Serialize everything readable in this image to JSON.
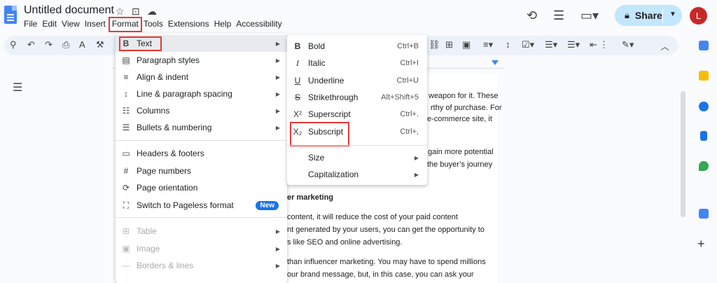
{
  "document": {
    "title": "Untitled document"
  },
  "menubar": [
    "File",
    "Edit",
    "View",
    "Insert",
    "Format",
    "Tools",
    "Extensions",
    "Help",
    "Accessibility"
  ],
  "share": {
    "label": "Share"
  },
  "avatar": {
    "initial": "L"
  },
  "format_menu": {
    "items": [
      {
        "label": "Text",
        "icon": "bold-icon",
        "submenu": true
      },
      {
        "label": "Paragraph styles",
        "icon": "paragraph-styles-icon",
        "submenu": true
      },
      {
        "label": "Align & indent",
        "icon": "align-icon",
        "submenu": true
      },
      {
        "label": "Line & paragraph spacing",
        "icon": "line-spacing-icon",
        "submenu": true
      },
      {
        "label": "Columns",
        "icon": "columns-icon",
        "submenu": true
      },
      {
        "label": "Bullets & numbering",
        "icon": "bullets-icon",
        "submenu": true
      },
      {
        "label": "Headers & footers",
        "icon": "headers-icon",
        "submenu": false
      },
      {
        "label": "Page numbers",
        "icon": "hash-icon",
        "submenu": false
      },
      {
        "label": "Page orientation",
        "icon": "page-orientation-icon",
        "submenu": false
      },
      {
        "label": "Switch to Pageless format",
        "icon": "pageless-icon",
        "submenu": false,
        "badge": "New"
      },
      {
        "label": "Table",
        "icon": "table-icon",
        "submenu": true,
        "disabled": true
      },
      {
        "label": "Image",
        "icon": "image-icon",
        "submenu": true,
        "disabled": true
      },
      {
        "label": "Borders & lines",
        "icon": "borders-icon",
        "submenu": true,
        "disabled": true
      }
    ]
  },
  "text_submenu": {
    "items": [
      {
        "label": "Bold",
        "shortcut": "Ctrl+B",
        "icon": "bold-icon"
      },
      {
        "label": "Italic",
        "shortcut": "Ctrl+I",
        "icon": "italic-icon"
      },
      {
        "label": "Underline",
        "shortcut": "Ctrl+U",
        "icon": "underline-icon"
      },
      {
        "label": "Strikethrough",
        "shortcut": "Alt+Shift+5",
        "icon": "strikethrough-icon"
      },
      {
        "label": "Superscript",
        "shortcut": "Ctrl+.",
        "icon": "superscript-icon"
      },
      {
        "label": "Subscript",
        "shortcut": "Ctrl+,",
        "icon": "subscript-icon"
      },
      {
        "label": "Size",
        "submenu": true
      },
      {
        "label": "Capitalization",
        "submenu": true
      }
    ]
  },
  "doc_text": [
    "weapon for it. These",
    "rthy of purchase. For",
    "e-commerce site, it",
    "gain more potential",
    "the buyer’s journey",
    "er marketing",
    "content, it will reduce the cost of your paid content",
    "nt generated by your users, you can get the opportunity to",
    "s like SEO and online advertising.",
    "than influencer marketing. You may have to spend millions",
    "our brand message, but, in this case, you can ask your"
  ],
  "colors": {
    "accent": "#1a73e8",
    "highlight": "#e53935",
    "share_bg": "#c2e7ff",
    "avatar_bg": "#c62828"
  }
}
